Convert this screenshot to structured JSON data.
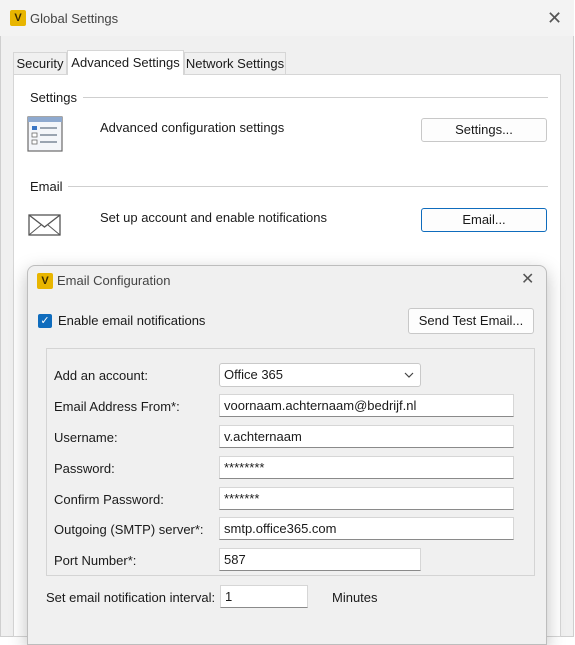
{
  "window": {
    "title": "Global Settings",
    "app_icon_letter": "V",
    "close_label": "✕"
  },
  "tabs": [
    {
      "label": "Security",
      "active": false
    },
    {
      "label": "Advanced Settings",
      "active": true
    },
    {
      "label": "Network Settings",
      "active": false
    }
  ],
  "settings_group": {
    "label": "Settings",
    "description": "Advanced configuration settings",
    "button": "Settings...",
    "icon": "settings-list-icon"
  },
  "email_group": {
    "label": "Email",
    "description": "Set up account and enable notifications",
    "button": "Email...",
    "icon": "envelope-icon"
  },
  "email_dialog": {
    "title": "Email Configuration",
    "app_icon_letter": "V",
    "close_label": "✕",
    "enable_notifications": {
      "label": "Enable email notifications",
      "checked": true
    },
    "send_test_button": "Send Test Email...",
    "fields": {
      "account": {
        "label": "Add an account:",
        "value": "Office 365"
      },
      "email_from": {
        "label": "Email Address From*:",
        "value": "voornaam.achternaam@bedrijf.nl"
      },
      "username": {
        "label": "Username:",
        "value": "v.achternaam"
      },
      "password": {
        "label": "Password:",
        "value": "********"
      },
      "confirm_password": {
        "label": "Confirm Password:",
        "value": "*******"
      },
      "smtp_server": {
        "label": "Outgoing (SMTP) server*:",
        "value": "smtp.office365.com"
      },
      "port": {
        "label": "Port Number*:",
        "value": "587"
      }
    },
    "interval": {
      "label": "Set email notification interval:",
      "value": "1",
      "unit": "Minutes"
    }
  },
  "colors": {
    "accent": "#0f6cbd",
    "app_icon": "#e8b500"
  }
}
